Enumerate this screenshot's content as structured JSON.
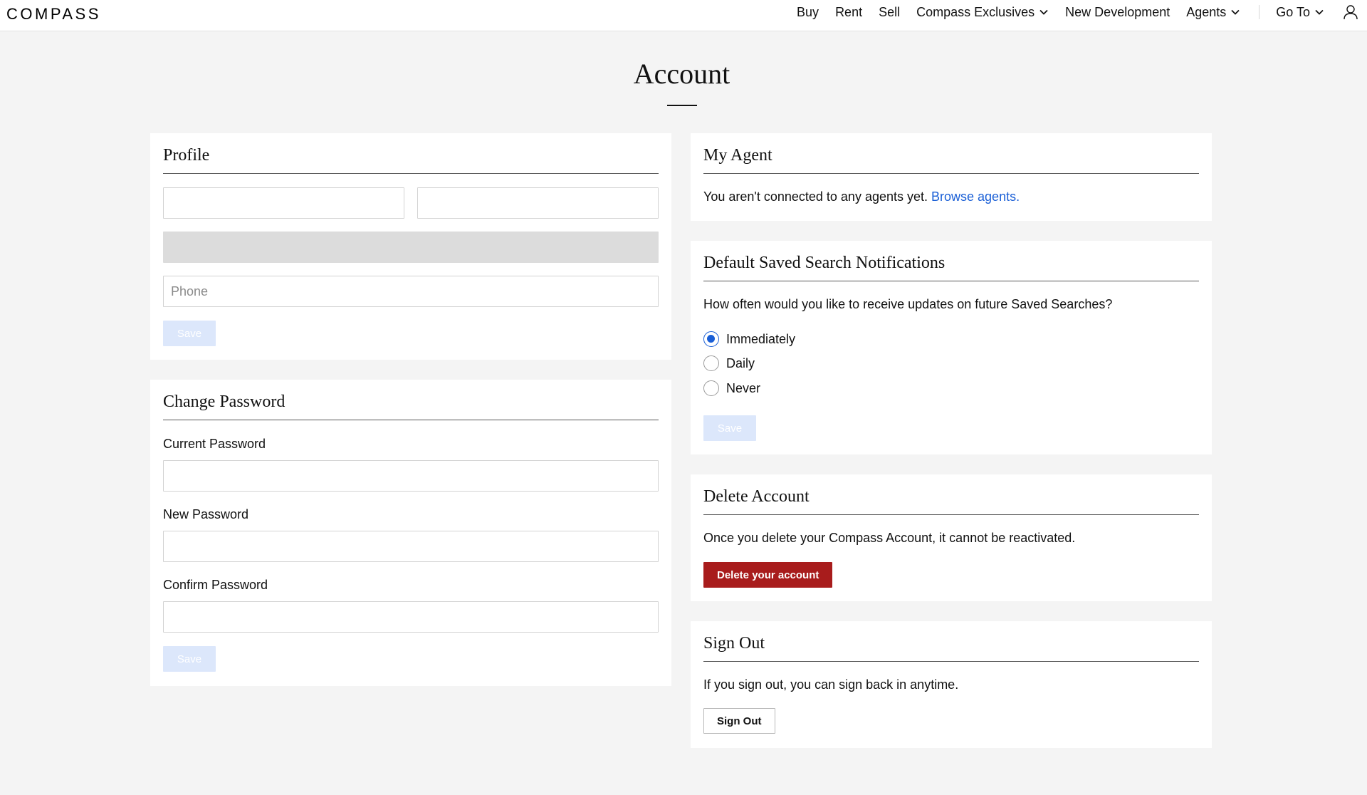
{
  "header": {
    "logo": "COMPASS",
    "nav": [
      {
        "label": "Buy",
        "dropdown": false
      },
      {
        "label": "Rent",
        "dropdown": false
      },
      {
        "label": "Sell",
        "dropdown": false
      },
      {
        "label": "Compass Exclusives",
        "dropdown": true
      },
      {
        "label": "New Development",
        "dropdown": false
      },
      {
        "label": "Agents",
        "dropdown": true
      },
      {
        "label": "Go To",
        "dropdown": true
      }
    ]
  },
  "page": {
    "title": "Account"
  },
  "profile": {
    "heading": "Profile",
    "first_name": "",
    "last_name": "",
    "email": "",
    "phone_placeholder": "Phone",
    "save_label": "Save"
  },
  "change_password": {
    "heading": "Change Password",
    "current_label": "Current Password",
    "new_label": "New Password",
    "confirm_label": "Confirm Password",
    "save_label": "Save"
  },
  "my_agent": {
    "heading": "My Agent",
    "text": "You aren't connected to any agents yet.",
    "link": "Browse agents."
  },
  "notifications": {
    "heading": "Default Saved Search Notifications",
    "question": "How often would you like to receive updates on future Saved Searches?",
    "options": [
      {
        "label": "Immediately",
        "selected": true
      },
      {
        "label": "Daily",
        "selected": false
      },
      {
        "label": "Never",
        "selected": false
      }
    ],
    "save_label": "Save"
  },
  "delete_account": {
    "heading": "Delete Account",
    "text": "Once you delete your Compass Account, it cannot be reactivated.",
    "button": "Delete your account"
  },
  "sign_out": {
    "heading": "Sign Out",
    "text": "If you sign out, you can sign back in anytime.",
    "button": "Sign Out"
  },
  "colors": {
    "accent_blue": "#1a5fd6",
    "delete_red": "#a81c1c",
    "save_disabled": "#dce7fb",
    "page_bg": "#f4f4f4"
  }
}
